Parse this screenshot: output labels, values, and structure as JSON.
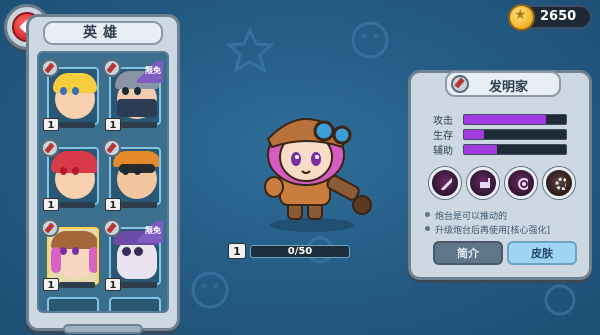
{
  "hero_panel": {
    "title": "英雄",
    "heroes": [
      {
        "name": "blonde-hero",
        "level": "1",
        "badge": ""
      },
      {
        "name": "ninja-hero",
        "level": "1",
        "badge": "限免"
      },
      {
        "name": "redhair-hero",
        "level": "1",
        "badge": ""
      },
      {
        "name": "goggle-hero",
        "level": "1",
        "badge": ""
      },
      {
        "name": "inventor-hero",
        "level": "1",
        "badge": ""
      },
      {
        "name": "skull-hero",
        "level": "1",
        "badge": "限免"
      }
    ]
  },
  "currency": {
    "coins": "2650"
  },
  "character": {
    "level": "1",
    "xp": "0/50"
  },
  "detail": {
    "name": "发明家",
    "stats": [
      {
        "label": "攻击",
        "value": 0.8
      },
      {
        "label": "生存",
        "value": 0.2
      },
      {
        "label": "辅助",
        "value": 0.32
      }
    ],
    "skills": [
      "blade-skill",
      "turret-skill",
      "orb-skill",
      "gear-skill"
    ],
    "descriptions": [
      "炮台是可以推动的",
      "升级炮台后再使用[核心强化]"
    ],
    "tabs": {
      "intro": "简介",
      "skin": "皮肤"
    }
  },
  "colors": {
    "stat_fill": "#a23be0",
    "background": "#2a6690"
  }
}
